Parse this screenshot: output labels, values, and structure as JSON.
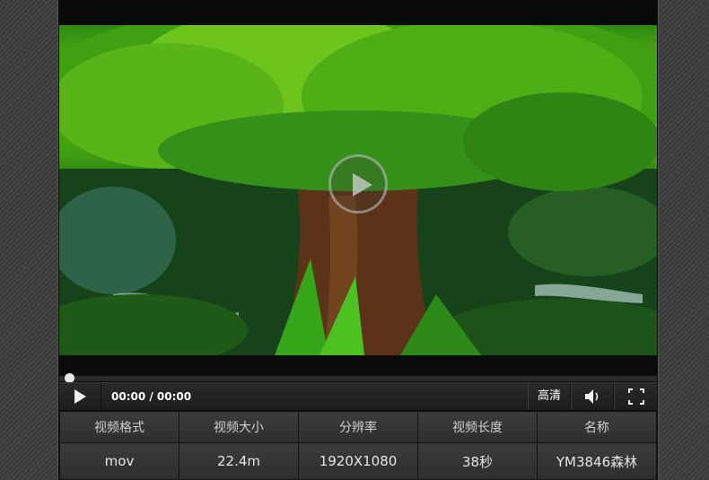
{
  "player": {
    "time_display": "00:00 / 00:00",
    "quality_label": "高清",
    "progress": 0
  },
  "icons": {
    "play": "play-icon",
    "overlay_play": "play-circle-icon",
    "volume": "volume-icon",
    "fullscreen": "fullscreen-icon"
  },
  "info_table": {
    "headers": [
      "视频格式",
      "视频大小",
      "分辨率",
      "视频长度",
      "名称"
    ],
    "values": [
      "mov",
      "22.4m",
      "1920X1080",
      "38秒",
      "YM3846森林"
    ]
  }
}
